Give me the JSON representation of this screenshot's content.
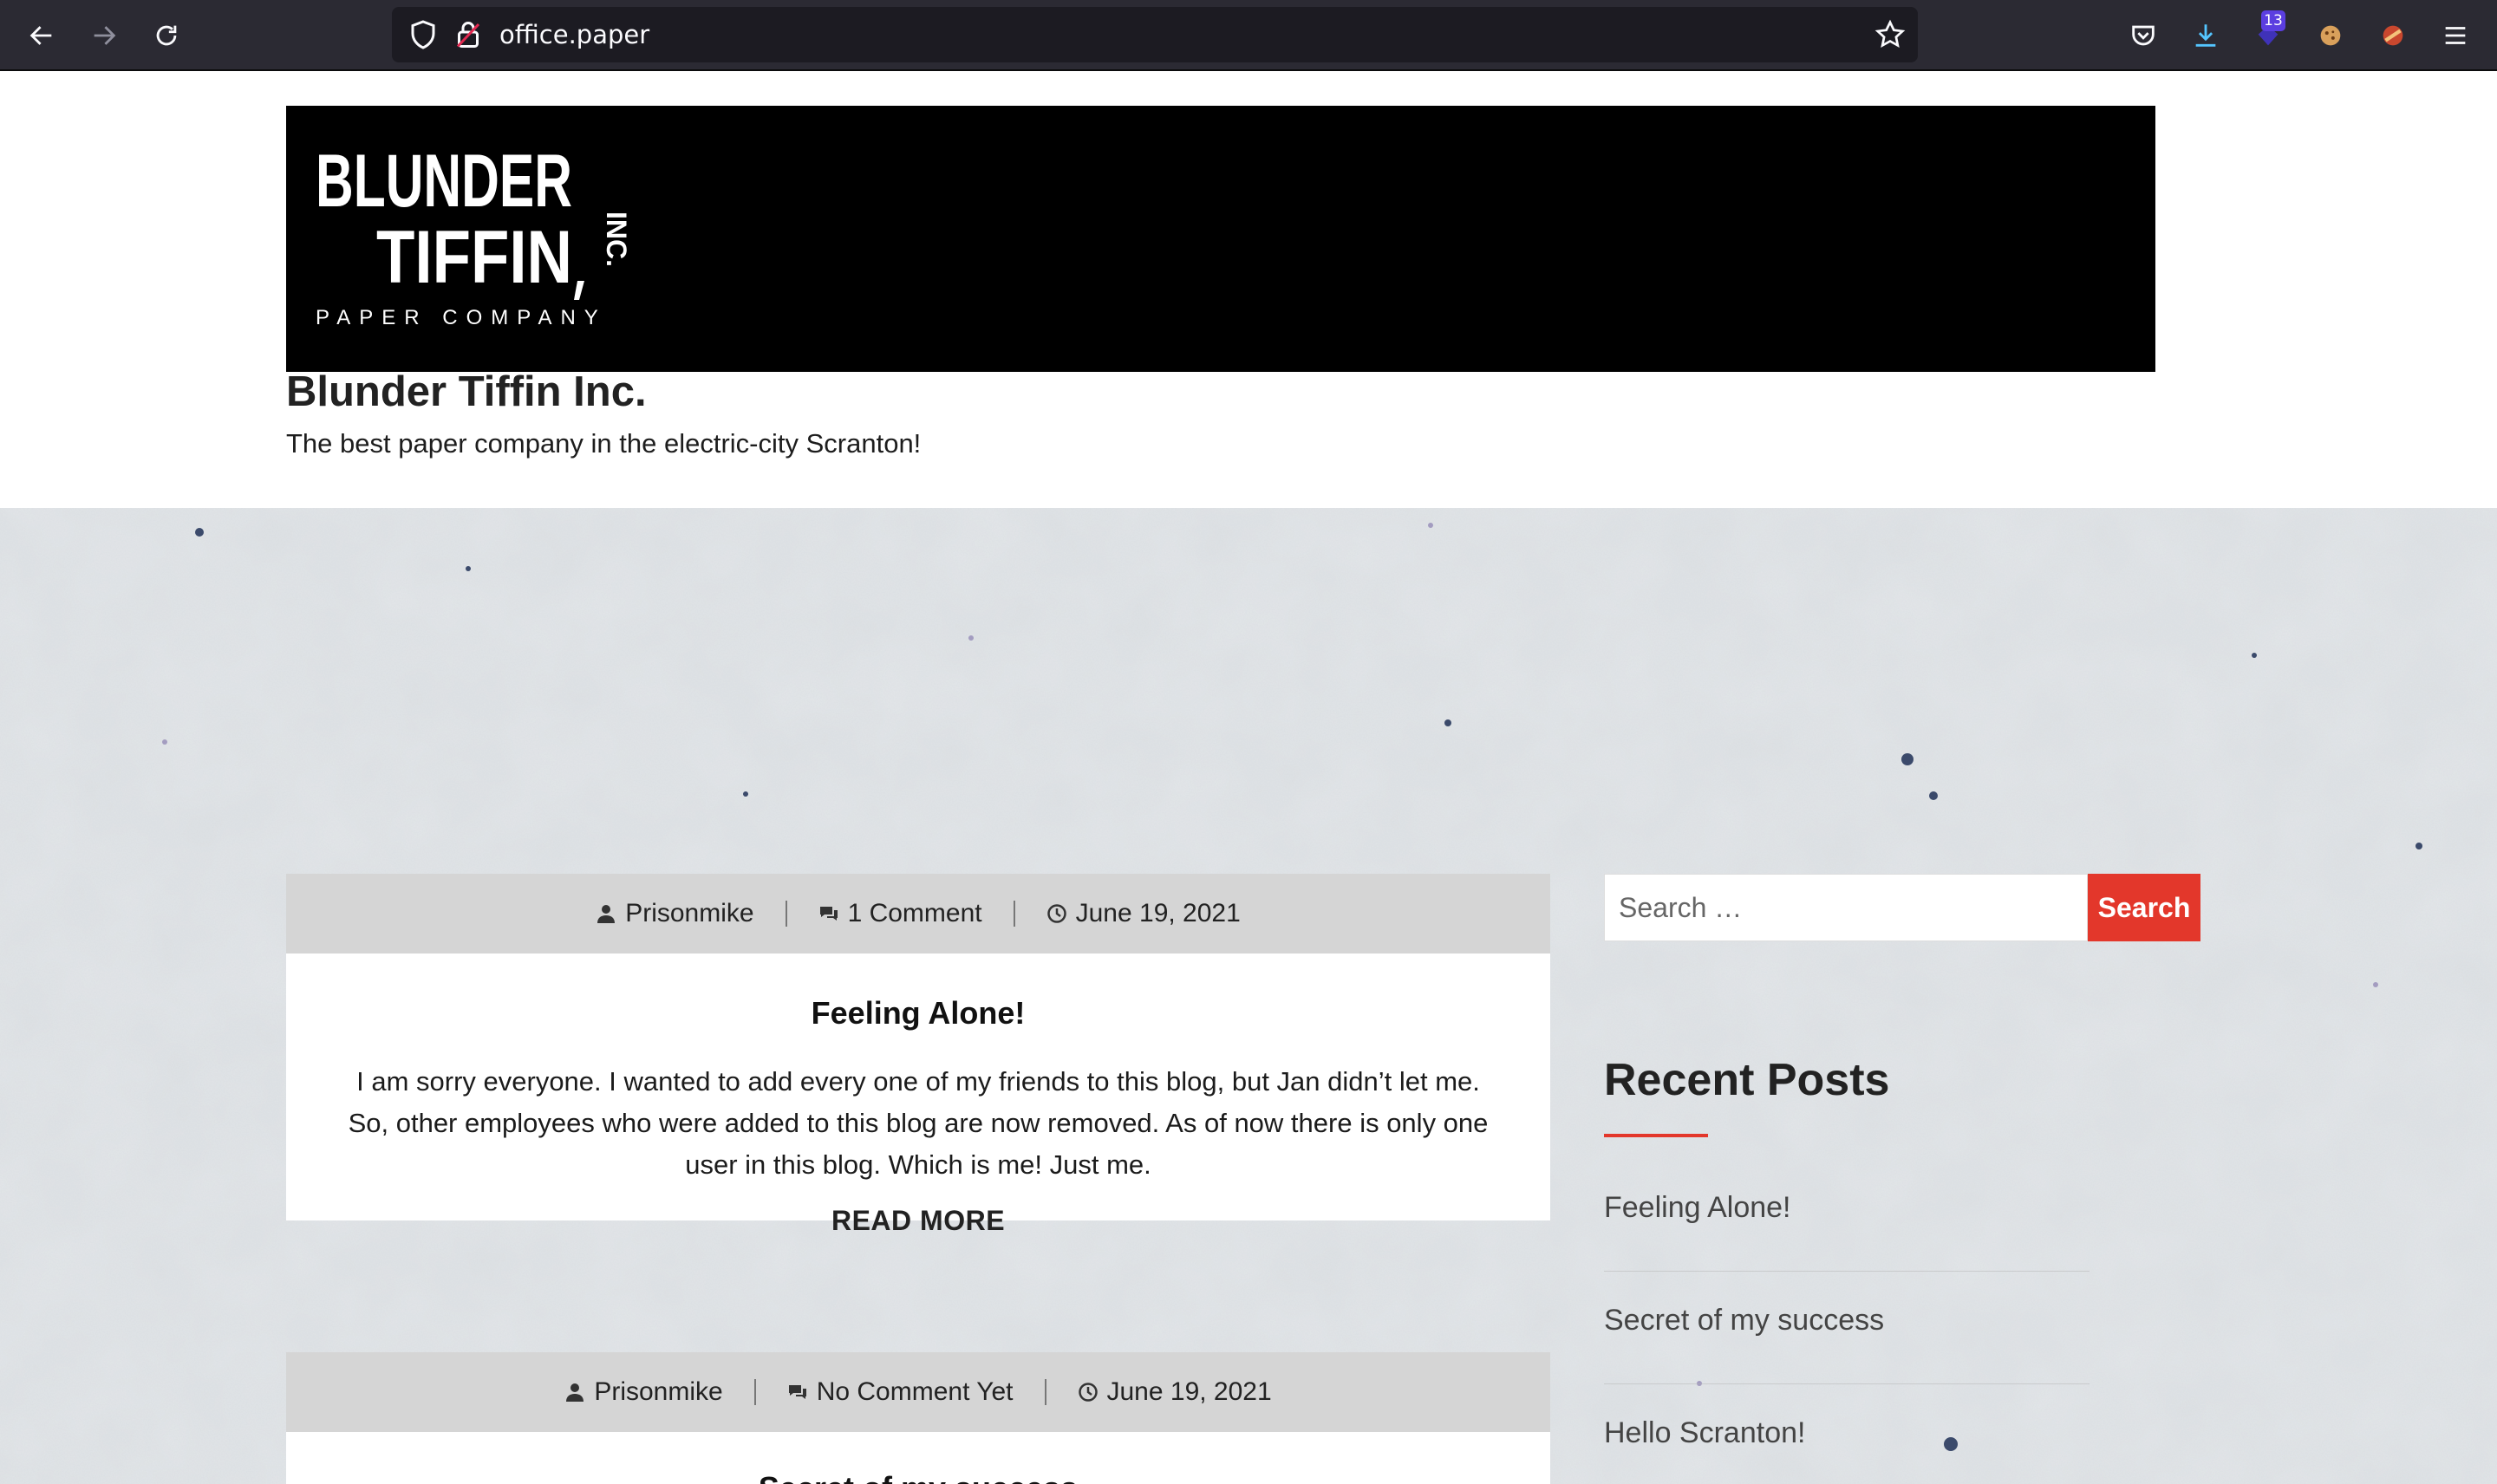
{
  "browser": {
    "url": "office.paper",
    "extension_badge_count": "13"
  },
  "site": {
    "logo": {
      "line1": "BLUNDER",
      "line2": "TIFFIN",
      "inc": "INC.",
      "sub": "PAPER COMPANY"
    },
    "title": "Blunder Tiffin Inc.",
    "tagline": "The best paper company in the electric-city Scranton!"
  },
  "posts": [
    {
      "author": "Prisonmike",
      "comments": "1 Comment",
      "date": "June 19, 2021",
      "title": "Feeling Alone!",
      "excerpt": "I am sorry everyone. I wanted to add every one of my friends to this blog, but Jan didn’t let me. So, other employees who were added to this blog are now removed. As of now there is only one user in this blog. Which is me! Just me.",
      "read_more": "READ MORE"
    },
    {
      "author": "Prisonmike",
      "comments": "No Comment Yet",
      "date": "June 19, 2021",
      "title": "Secret of my success"
    }
  ],
  "sidebar": {
    "search_placeholder": "Search …",
    "search_button": "Search",
    "recent_title": "Recent Posts",
    "recent_posts": [
      "Feeling Alone!",
      "Secret of my success",
      "Hello Scranton!"
    ]
  },
  "colors": {
    "accent": "#e3372b",
    "chrome": "#2b2a33",
    "meta_bar": "#d5d5d5"
  }
}
